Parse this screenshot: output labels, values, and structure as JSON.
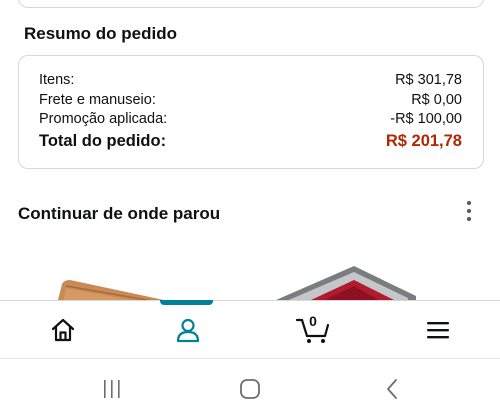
{
  "order_summary": {
    "title": "Resumo do pedido",
    "rows": [
      {
        "label": "Itens:",
        "value": "R$ 301,78"
      },
      {
        "label": "Frete e manuseio:",
        "value": "R$ 0,00"
      },
      {
        "label": "Promoção aplicada:",
        "value": "-R$ 100,00"
      }
    ],
    "total": {
      "label": "Total do pedido:",
      "value": "R$ 201,78"
    }
  },
  "continue_section": {
    "title": "Continuar de onde parou",
    "more_icon": "more-vertical-icon"
  },
  "bottom_nav": {
    "items": [
      {
        "icon": "home-icon"
      },
      {
        "icon": "user-icon",
        "active": true
      },
      {
        "icon": "cart-icon",
        "count": "0"
      },
      {
        "icon": "hamburger-menu-icon"
      }
    ],
    "accent_color": "#008296"
  },
  "system_nav": {
    "items": [
      {
        "icon": "recents-icon"
      },
      {
        "icon": "home-circle-icon"
      },
      {
        "icon": "back-icon"
      }
    ]
  },
  "colors": {
    "total_value": "#b12704",
    "border": "#d5d9d9",
    "text": "#0f1111"
  }
}
